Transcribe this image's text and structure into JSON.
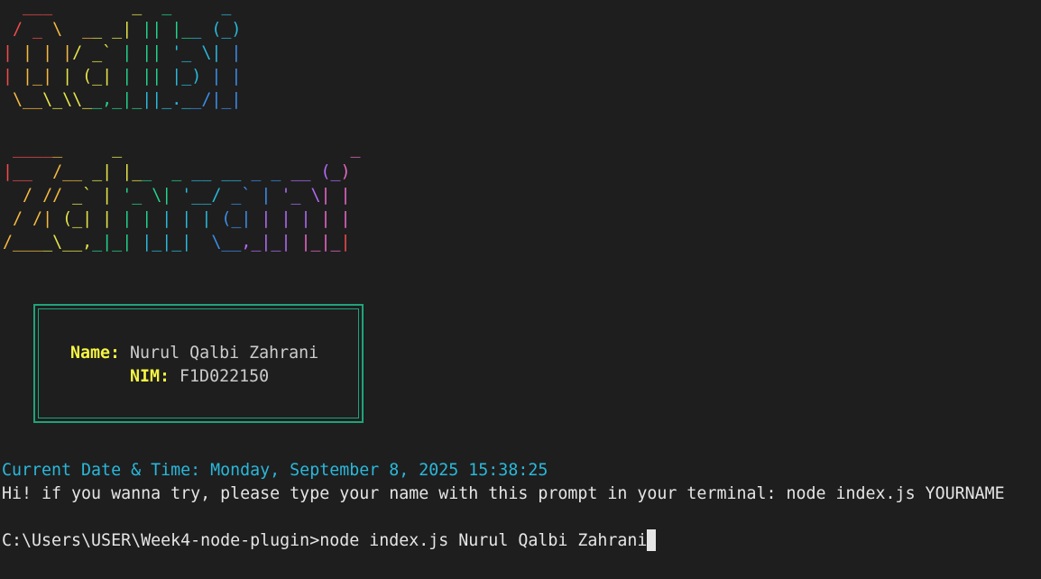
{
  "banner": {
    "line1_rows": [
      "  ___        _  _     _",
      " / _ \\  __ _| || |__ (_)",
      "| | | |/ _` | || '_ \\| |",
      "| |_| | (_| | || |_) | |",
      " \\__\\_\\\\__,_|_||_.__/|_|"
    ],
    "line2_rows": [
      " _____     _                       _",
      "|__  /__ _| |__  _ __ __ _ _ __ (_)",
      "  / // _` | '_ \\| '__/ _` | '_ \\| |",
      " / /| (_| | | | | | | (_| | | | | |",
      "/____\\__,_|_| |_|_|  \\__,_|_| |_|_|"
    ],
    "rainbow_colors": [
      "#f14c4c",
      "#f5b942",
      "#e5e54c",
      "#23d18b",
      "#29b8db",
      "#3b8eea",
      "#b16cf5",
      "#e868c8"
    ]
  },
  "info_box": {
    "name_label": "Name:",
    "name_value": "Nurul Qalbi Zahrani",
    "nim_label": "NIM:",
    "nim_value": "F1D022150",
    "border_color": "#1fa37a",
    "label_color": "#f5f543"
  },
  "datetime": {
    "text": "Current Date & Time: Monday, September 8, 2025 15:38:25",
    "color": "#29b8db"
  },
  "hint": {
    "text": "Hi! if you wanna try, please type your name with this prompt in your terminal: node index.js YOURNAME"
  },
  "prompt": {
    "path": "C:\\Users\\USER\\Week4-node-plugin>",
    "command": "node index.js Nurul Qalbi Zahrani"
  }
}
